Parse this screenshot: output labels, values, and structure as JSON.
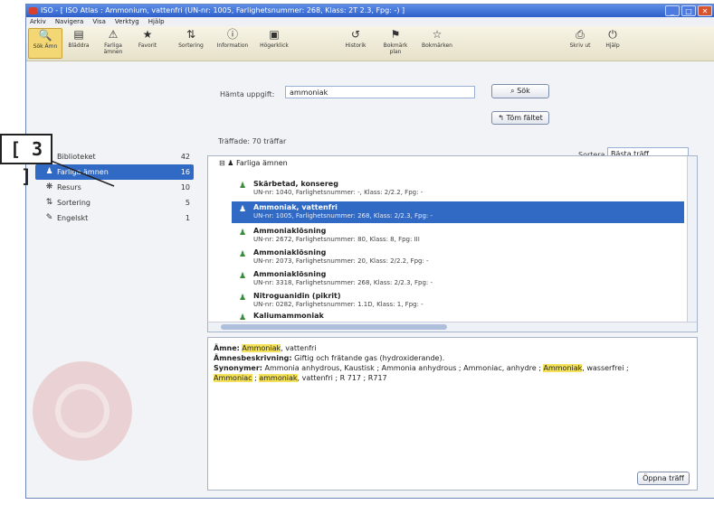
{
  "window": {
    "title": "ISO - [ ISO Atlas : Ammonium, vattenfri (UN-nr: 1005, Farlighetsnummer: 268, Klass: 2T 2.3, Fpg: -) ]",
    "controls": [
      "_",
      "□",
      "✕"
    ]
  },
  "menu": [
    "Arkiv",
    "Navigera",
    "Visa",
    "Verktyg",
    "Hjälp"
  ],
  "toolbar": [
    {
      "label": "Sök Ämn",
      "icon": "search-icon",
      "active": true
    },
    {
      "label": "Bläddra",
      "icon": "browse-icon"
    },
    {
      "label": "Farliga ämnen",
      "icon": "hazard-icon"
    },
    {
      "label": "Favorit",
      "icon": "favorite-icon"
    },
    {
      "label": "Sortering",
      "icon": "sort-icon"
    },
    {
      "label": "Information",
      "icon": "info-icon"
    },
    {
      "label": "Högerklick",
      "icon": "rightclick-icon"
    },
    {
      "label": "Historik",
      "icon": "history-icon"
    },
    {
      "label": "Bokmärk plan",
      "icon": "bookmark-plan-icon"
    },
    {
      "label": "Bokmärken",
      "icon": "bookmarks-icon"
    },
    {
      "label": "Skriv ut",
      "icon": "print-icon"
    },
    {
      "label": "Hjälp",
      "icon": "help-icon"
    }
  ],
  "search": {
    "label": "Hämta uppgift:",
    "value": "ammoniak",
    "search_button": "Sök",
    "clear_button": "Töm fältet"
  },
  "results": {
    "hits_label": "Träffade: 70 träffar",
    "sort_label": "Sortera på",
    "sort_value": "Bästa träff",
    "group_label": "Farliga ämnen",
    "rows": [
      {
        "title": "Skärbetad, konsereg",
        "sub": "UN-nr: 1040, Farlighetsnummer: -, Klass: 2/2.2, Fpg: -"
      },
      {
        "title": "Ammoniak, vattenfri",
        "sub": "UN-nr: 1005, Farlighetsnummer: 268, Klass: 2/2.3, Fpg: -"
      },
      {
        "title": "Ammoniaklösning",
        "sub": "UN-nr: 2672, Farlighetsnummer: 80, Klass: 8, Fpg: III"
      },
      {
        "title": "Ammoniaklösning",
        "sub": "UN-nr: 2073, Farlighetsnummer: 20, Klass: 2/2.2, Fpg: -"
      },
      {
        "title": "Ammoniaklösning",
        "sub": "UN-nr: 3318, Farlighetsnummer: 268, Klass: 2/2.3, Fpg: -"
      },
      {
        "title": "Nitroguanidin (pikrit)",
        "sub": "UN-nr: 0282, Farlighetsnummer: 1.1D, Klass: 1, Fpg: -"
      },
      {
        "title": "Kaliumammoniak",
        "sub": ""
      }
    ]
  },
  "sidebar": {
    "items": [
      {
        "label": "Biblioteket",
        "count": "42",
        "icon": "library-icon"
      },
      {
        "label": "Farliga ämnen",
        "count": "16",
        "icon": "hazard-icon"
      },
      {
        "label": "Resurs",
        "count": "10",
        "icon": "resource-icon"
      },
      {
        "label": "Sortering",
        "count": "5",
        "icon": "sort-icon"
      },
      {
        "label": "Engelskt",
        "count": "1",
        "icon": "english-icon"
      }
    ]
  },
  "detail": {
    "lines": [
      [
        {
          "text": "Ämne:",
          "bold": true
        },
        {
          "text": " "
        },
        {
          "text": "Ammoniak",
          "hl": true
        },
        {
          "text": ", vattenfri"
        }
      ],
      [
        {
          "text": "Ämnesbeskrivning:",
          "bold": true
        },
        {
          "text": " Giftig och frätande gas (hydroxiderande)."
        }
      ],
      [
        {
          "text": "Synonymer:",
          "bold": true
        },
        {
          "text": " Ammonia anhydrous, Kaustisk ; Ammonia anhydrous ; Ammoniac, anhydre ; "
        },
        {
          "text": "Ammoniak",
          "hl": true
        },
        {
          "text": ", wasserfrei ;"
        }
      ],
      [
        {
          "text": "Ammoniac",
          "hl": true
        },
        {
          "text": " ; "
        },
        {
          "text": "ammoniak",
          "hl": true
        },
        {
          "text": ", vattenfri ; R 717 ; R717"
        }
      ]
    ],
    "open_button": "Öppna träff"
  },
  "annotation": "[ 3 ]",
  "colors": {
    "selection": "#316ac5",
    "highlight": "#f4e35a",
    "titlebar": "#2d5fc9"
  }
}
